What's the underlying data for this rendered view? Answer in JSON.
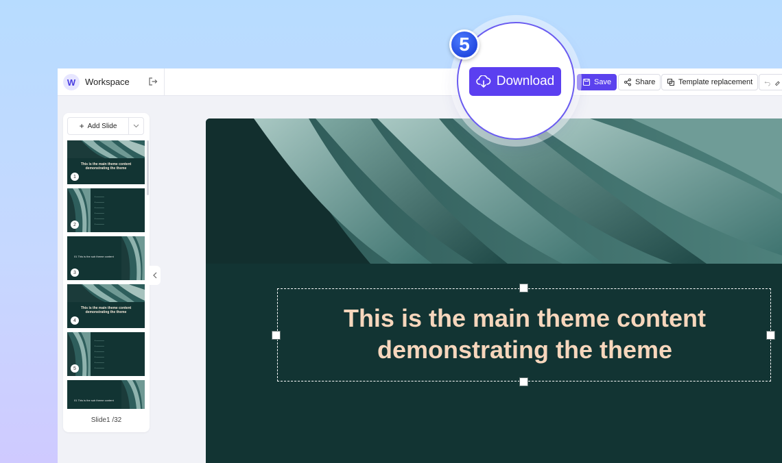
{
  "workspace": {
    "avatar_letter": "W",
    "title": "Workspace"
  },
  "toolbar": {
    "download_label": "Download",
    "save_label": "Save",
    "share_label": "Share",
    "template_label": "Template replacement"
  },
  "step": {
    "number": "5"
  },
  "sidebar": {
    "add_slide_label": "Add Slide",
    "slide_count": "Slide1 /32",
    "thumbnails": [
      {
        "number": "1",
        "title": "This is the main theme content demonstrating the theme"
      },
      {
        "number": "2"
      },
      {
        "number": "3",
        "title": "01 This is the sub theme content"
      },
      {
        "number": "4",
        "title": "This is the main theme content demonstrating the theme"
      },
      {
        "number": "5"
      },
      {
        "number": "",
        "title": "01 This is the sub theme content"
      }
    ]
  },
  "slide": {
    "title": "This is the main theme content demonstrating the theme"
  },
  "colors": {
    "accent": "#5b3ff0",
    "slide_bg": "#123433",
    "title_text": "#f6d6bc"
  }
}
